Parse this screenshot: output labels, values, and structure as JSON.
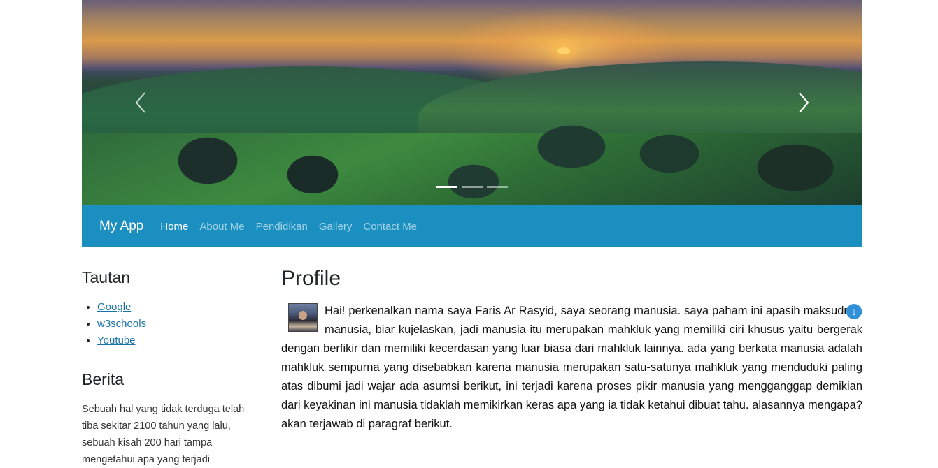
{
  "carousel": {
    "prev_label": "Previous",
    "next_label": "Next",
    "slide_count": 3,
    "active_slide": 1
  },
  "navbar": {
    "brand": "My App",
    "items": [
      {
        "label": "Home",
        "active": true
      },
      {
        "label": "About Me",
        "active": false
      },
      {
        "label": "Pendidikan",
        "active": false
      },
      {
        "label": "Gallery",
        "active": false
      },
      {
        "label": "Contact Me",
        "active": false
      }
    ],
    "color": "#1b8fc0"
  },
  "sidebar": {
    "links_title": "Tautan",
    "links": [
      "Google",
      "w3schools",
      "Youtube"
    ],
    "news_title": "Berita",
    "news_text": "Sebuah hal yang tidak terduga telah tiba sekitar 2100 tahun yang lalu, sebuah kisah 200 hari tampa mengetahui apa yang terjadi"
  },
  "main": {
    "title": "Profile",
    "body": "Hai! perkenalkan nama saya Faris Ar Rasyid, saya seorang manusia. saya paham ini apasih maksudnya manusia, biar kujelaskan, jadi manusia itu merupakan mahkluk yang memiliki ciri khusus yaitu bergerak dengan berfikir dan memiliki kecerdasan yang luar biasa dari mahkluk lainnya. ada yang berkata manusia adalah mahkluk sempurna yang disebabkan karena manusia merupakan satu-satunya mahkluk yang menduduki paling atas dibumi jadi wajar ada asumsi berikut, ini terjadi karena proses pikir manusia yang mengganggap demikian dari keyakinan ini manusia tidaklah memikirkan keras apa yang ia tidak ketahui dibuat tahu. alasannya mengapa? akan terjawab di paragraf berikut."
  }
}
